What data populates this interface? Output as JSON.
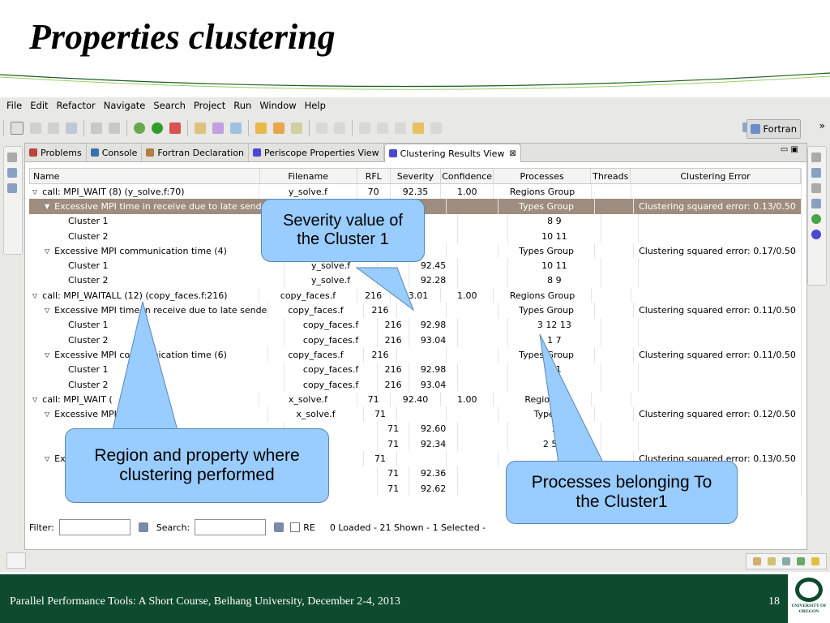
{
  "slide": {
    "title": "Properties clustering",
    "footer": "Parallel Performance Tools: A Short Course, Beihang University, December 2-4, 2013",
    "page_number": "18",
    "logo_text": "UNIVERSITY OF OREGON"
  },
  "menu": [
    "File",
    "Edit",
    "Refactor",
    "Navigate",
    "Search",
    "Project",
    "Run",
    "Window",
    "Help"
  ],
  "perspective": {
    "label": "Fortran"
  },
  "tabs": [
    {
      "label": "Problems",
      "icon": "problems-icon",
      "color": "#c04040"
    },
    {
      "label": "Console",
      "icon": "console-icon",
      "color": "#3a6fb0"
    },
    {
      "label": "Fortran Declaration",
      "icon": "declaration-icon",
      "color": "#b08040"
    },
    {
      "label": "Periscope Properties View",
      "icon": "periscope-icon",
      "color": "#4a4ad0"
    },
    {
      "label": "Clustering Results View",
      "icon": "clustering-icon",
      "color": "#4a4ad0",
      "active": true
    }
  ],
  "table": {
    "columns": [
      "Name",
      "Filename",
      "RFL",
      "Severity",
      "Confidence",
      "Processes",
      "Threads",
      "Clustering Error"
    ],
    "rows": [
      {
        "level": 0,
        "tri": "▽",
        "name": "call: MPI_WAIT (8) (y_solve.f:70)",
        "file": "y_solve.f",
        "rfl": "70",
        "sev": "92.35",
        "conf": "1.00",
        "proc": "Regions Group",
        "thr": "",
        "err": ""
      },
      {
        "level": 1,
        "tri": "▼",
        "name": "Excessive MPI time in receive due to late sende",
        "file": "",
        "rfl": "",
        "sev": "",
        "conf": "",
        "proc": "Types Group",
        "thr": "",
        "err": "Clustering squared error: 0.13/0.50",
        "selected": true
      },
      {
        "level": 2,
        "tri": "",
        "name": "Cluster 1",
        "file": "",
        "rfl": "",
        "sev": "",
        "conf": "",
        "proc": "8 9",
        "thr": "",
        "err": ""
      },
      {
        "level": 2,
        "tri": "",
        "name": "Cluster 2",
        "file": "",
        "rfl": "",
        "sev": "",
        "conf": "",
        "proc": "10 11",
        "thr": "",
        "err": ""
      },
      {
        "level": 1,
        "tri": "▽",
        "name": "Excessive MPI communication time (4)",
        "file": "",
        "rfl": "",
        "sev": "",
        "conf": "",
        "proc": "Types Group",
        "thr": "",
        "err": "Clustering squared error: 0.17/0.50"
      },
      {
        "level": 2,
        "tri": "",
        "name": "Cluster 1",
        "file": "y_solve.f",
        "rfl": "",
        "sev": "92.45",
        "conf": "",
        "proc": "10 11",
        "thr": "",
        "err": ""
      },
      {
        "level": 2,
        "tri": "",
        "name": "Cluster 2",
        "file": "y_solve.f",
        "rfl": "70",
        "sev": "92.28",
        "conf": "",
        "proc": "8 9",
        "thr": "",
        "err": ""
      },
      {
        "level": 0,
        "tri": "▽",
        "name": "call: MPI_WAITALL (12) (copy_faces.f:216)",
        "file": "copy_faces.f",
        "rfl": "216",
        "sev": "93.01",
        "conf": "1.00",
        "proc": "Regions Group",
        "thr": "",
        "err": ""
      },
      {
        "level": 1,
        "tri": "▽",
        "name": "Excessive MPI time in receive due to late sende",
        "file": "copy_faces.f",
        "rfl": "216",
        "sev": "",
        "conf": "",
        "proc": "Types Group",
        "thr": "",
        "err": "Clustering squared error: 0.11/0.50"
      },
      {
        "level": 2,
        "tri": "",
        "name": "Cluster 1",
        "file": "copy_faces.f",
        "rfl": "216",
        "sev": "92.98",
        "conf": "",
        "proc": "3 12 13",
        "thr": "",
        "err": ""
      },
      {
        "level": 2,
        "tri": "",
        "name": "Cluster 2",
        "file": "copy_faces.f",
        "rfl": "216",
        "sev": "93.04",
        "conf": "",
        "proc": "1 7",
        "thr": "",
        "err": ""
      },
      {
        "level": 1,
        "tri": "▽",
        "name": "Excessive MPI communication time (6)",
        "file": "copy_faces.f",
        "rfl": "216",
        "sev": "",
        "conf": "",
        "proc": "Types Group",
        "thr": "",
        "err": "Clustering squared error: 0.11/0.50"
      },
      {
        "level": 2,
        "tri": "",
        "name": "Cluster 1",
        "file": "copy_faces.f",
        "rfl": "216",
        "sev": "92.98",
        "conf": "",
        "proc": "3 1",
        "thr": "",
        "err": ""
      },
      {
        "level": 2,
        "tri": "",
        "name": "Cluster 2",
        "file": "copy_faces.f",
        "rfl": "216",
        "sev": "93.04",
        "conf": "",
        "proc": "1",
        "thr": "",
        "err": ""
      },
      {
        "level": 0,
        "tri": "▽",
        "name": "call: MPI_WAIT (",
        "file": "x_solve.f",
        "rfl": "71",
        "sev": "92.40",
        "conf": "1.00",
        "proc": "Regions",
        "thr": "",
        "err": ""
      },
      {
        "level": 1,
        "tri": "▽",
        "name": "Excessive MPI",
        "file": "x_solve.f",
        "rfl": "71",
        "sev": "",
        "conf": "",
        "proc": "Types",
        "thr": "",
        "err": "Clustering squared error: 0.12/0.50"
      },
      {
        "level": 2,
        "tri": "",
        "name": "",
        "file": "",
        "rfl": "71",
        "sev": "92.60",
        "conf": "",
        "proc": "1",
        "thr": "",
        "err": ""
      },
      {
        "level": 2,
        "tri": "",
        "name": "",
        "file": "",
        "rfl": "71",
        "sev": "92.34",
        "conf": "",
        "proc": "2 5 6",
        "thr": "",
        "err": ""
      },
      {
        "level": 1,
        "tri": "▽",
        "name": "Ex",
        "file": "",
        "rfl": "71",
        "sev": "",
        "conf": "",
        "proc": "",
        "thr": "",
        "err": "Clustering squared error: 0.13/0.50"
      },
      {
        "level": 2,
        "tri": "",
        "name": "",
        "file": "",
        "rfl": "71",
        "sev": "92.36",
        "conf": "",
        "proc": "",
        "thr": "",
        "err": ""
      },
      {
        "level": 2,
        "tri": "",
        "name": "",
        "file": "",
        "rfl": "71",
        "sev": "92.62",
        "conf": "",
        "proc": "",
        "thr": "",
        "err": ""
      }
    ]
  },
  "filterbar": {
    "filter_label": "Filter:",
    "search_label": "Search:",
    "re_label": "RE",
    "status": "0 Loaded - 21 Shown - 1 Selected -"
  },
  "callouts": {
    "severity": "Severity value of the Cluster 1",
    "region": "Region and property where clustering performed",
    "processes": "Processes belonging To the Cluster1"
  },
  "colors": {
    "footer_bg": "#0e4a2d",
    "callout_bg": "#99ccff",
    "selected_row": "#9e8c7e",
    "title_line": "#2e7d32"
  }
}
